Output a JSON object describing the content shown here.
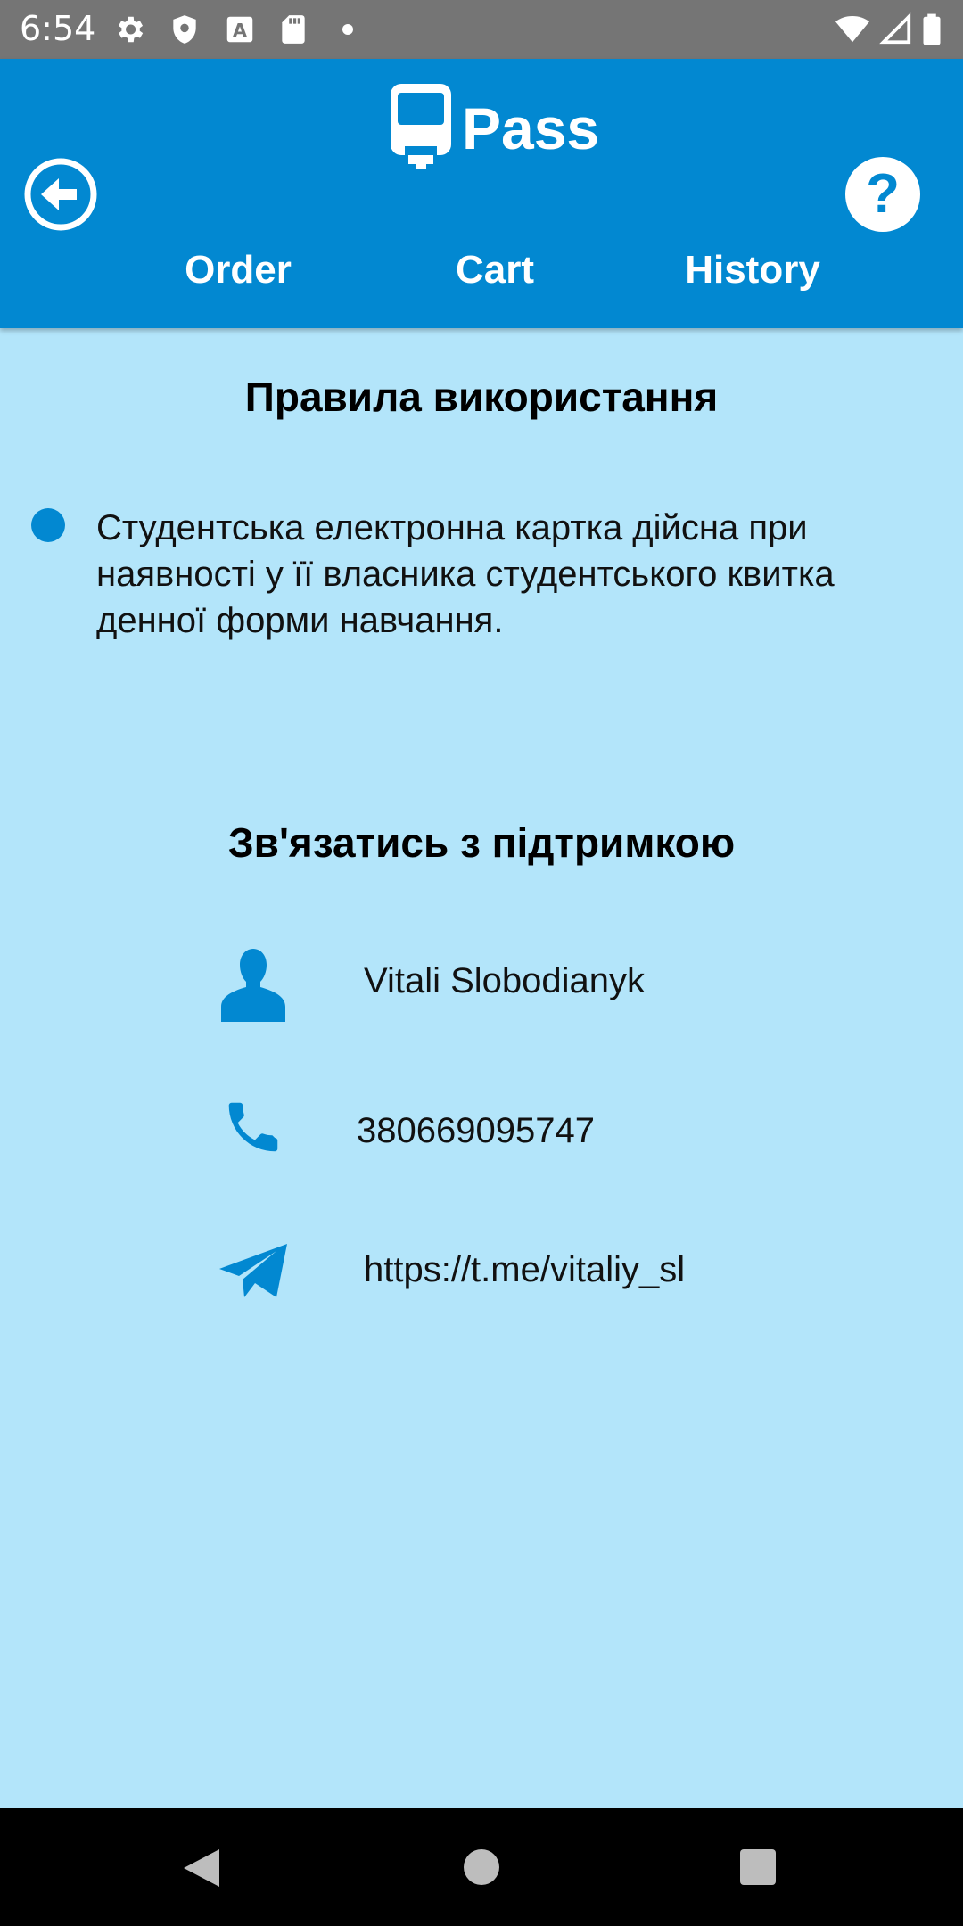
{
  "status_bar": {
    "time": "6:54",
    "left_icons": [
      "settings-icon",
      "shield-icon",
      "a-icon",
      "sd-card-icon",
      "dot-icon"
    ],
    "right_icons": [
      "wifi-icon",
      "signal-icon",
      "battery-icon"
    ]
  },
  "app_bar": {
    "title": "Pass",
    "logo": "tram-icon",
    "back_icon": "back-arrow-circle-icon",
    "help_label": "?",
    "tabs": [
      {
        "label": "Order"
      },
      {
        "label": "Cart"
      },
      {
        "label": "History"
      }
    ],
    "color": "#0288d1"
  },
  "rules": {
    "title": "Правила використання",
    "items": [
      {
        "text": " Студентська електронна картка дійсна при наявності у її власника студентського квитка денної форми навчання."
      }
    ]
  },
  "support": {
    "title": "Зв'язатись з підтримкою",
    "contacts": [
      {
        "icon": "person-icon",
        "text": "Vitali Slobodianyk"
      },
      {
        "icon": "phone-icon",
        "text": "380669095747"
      },
      {
        "icon": "telegram-icon",
        "text": "https://t.me/vitaliy_sl"
      }
    ]
  },
  "nav_bar": {
    "icons": [
      "nav-back-icon",
      "nav-home-icon",
      "nav-recents-icon"
    ]
  },
  "colors": {
    "background": "#b3e5fa",
    "accent": "#0288d1"
  }
}
